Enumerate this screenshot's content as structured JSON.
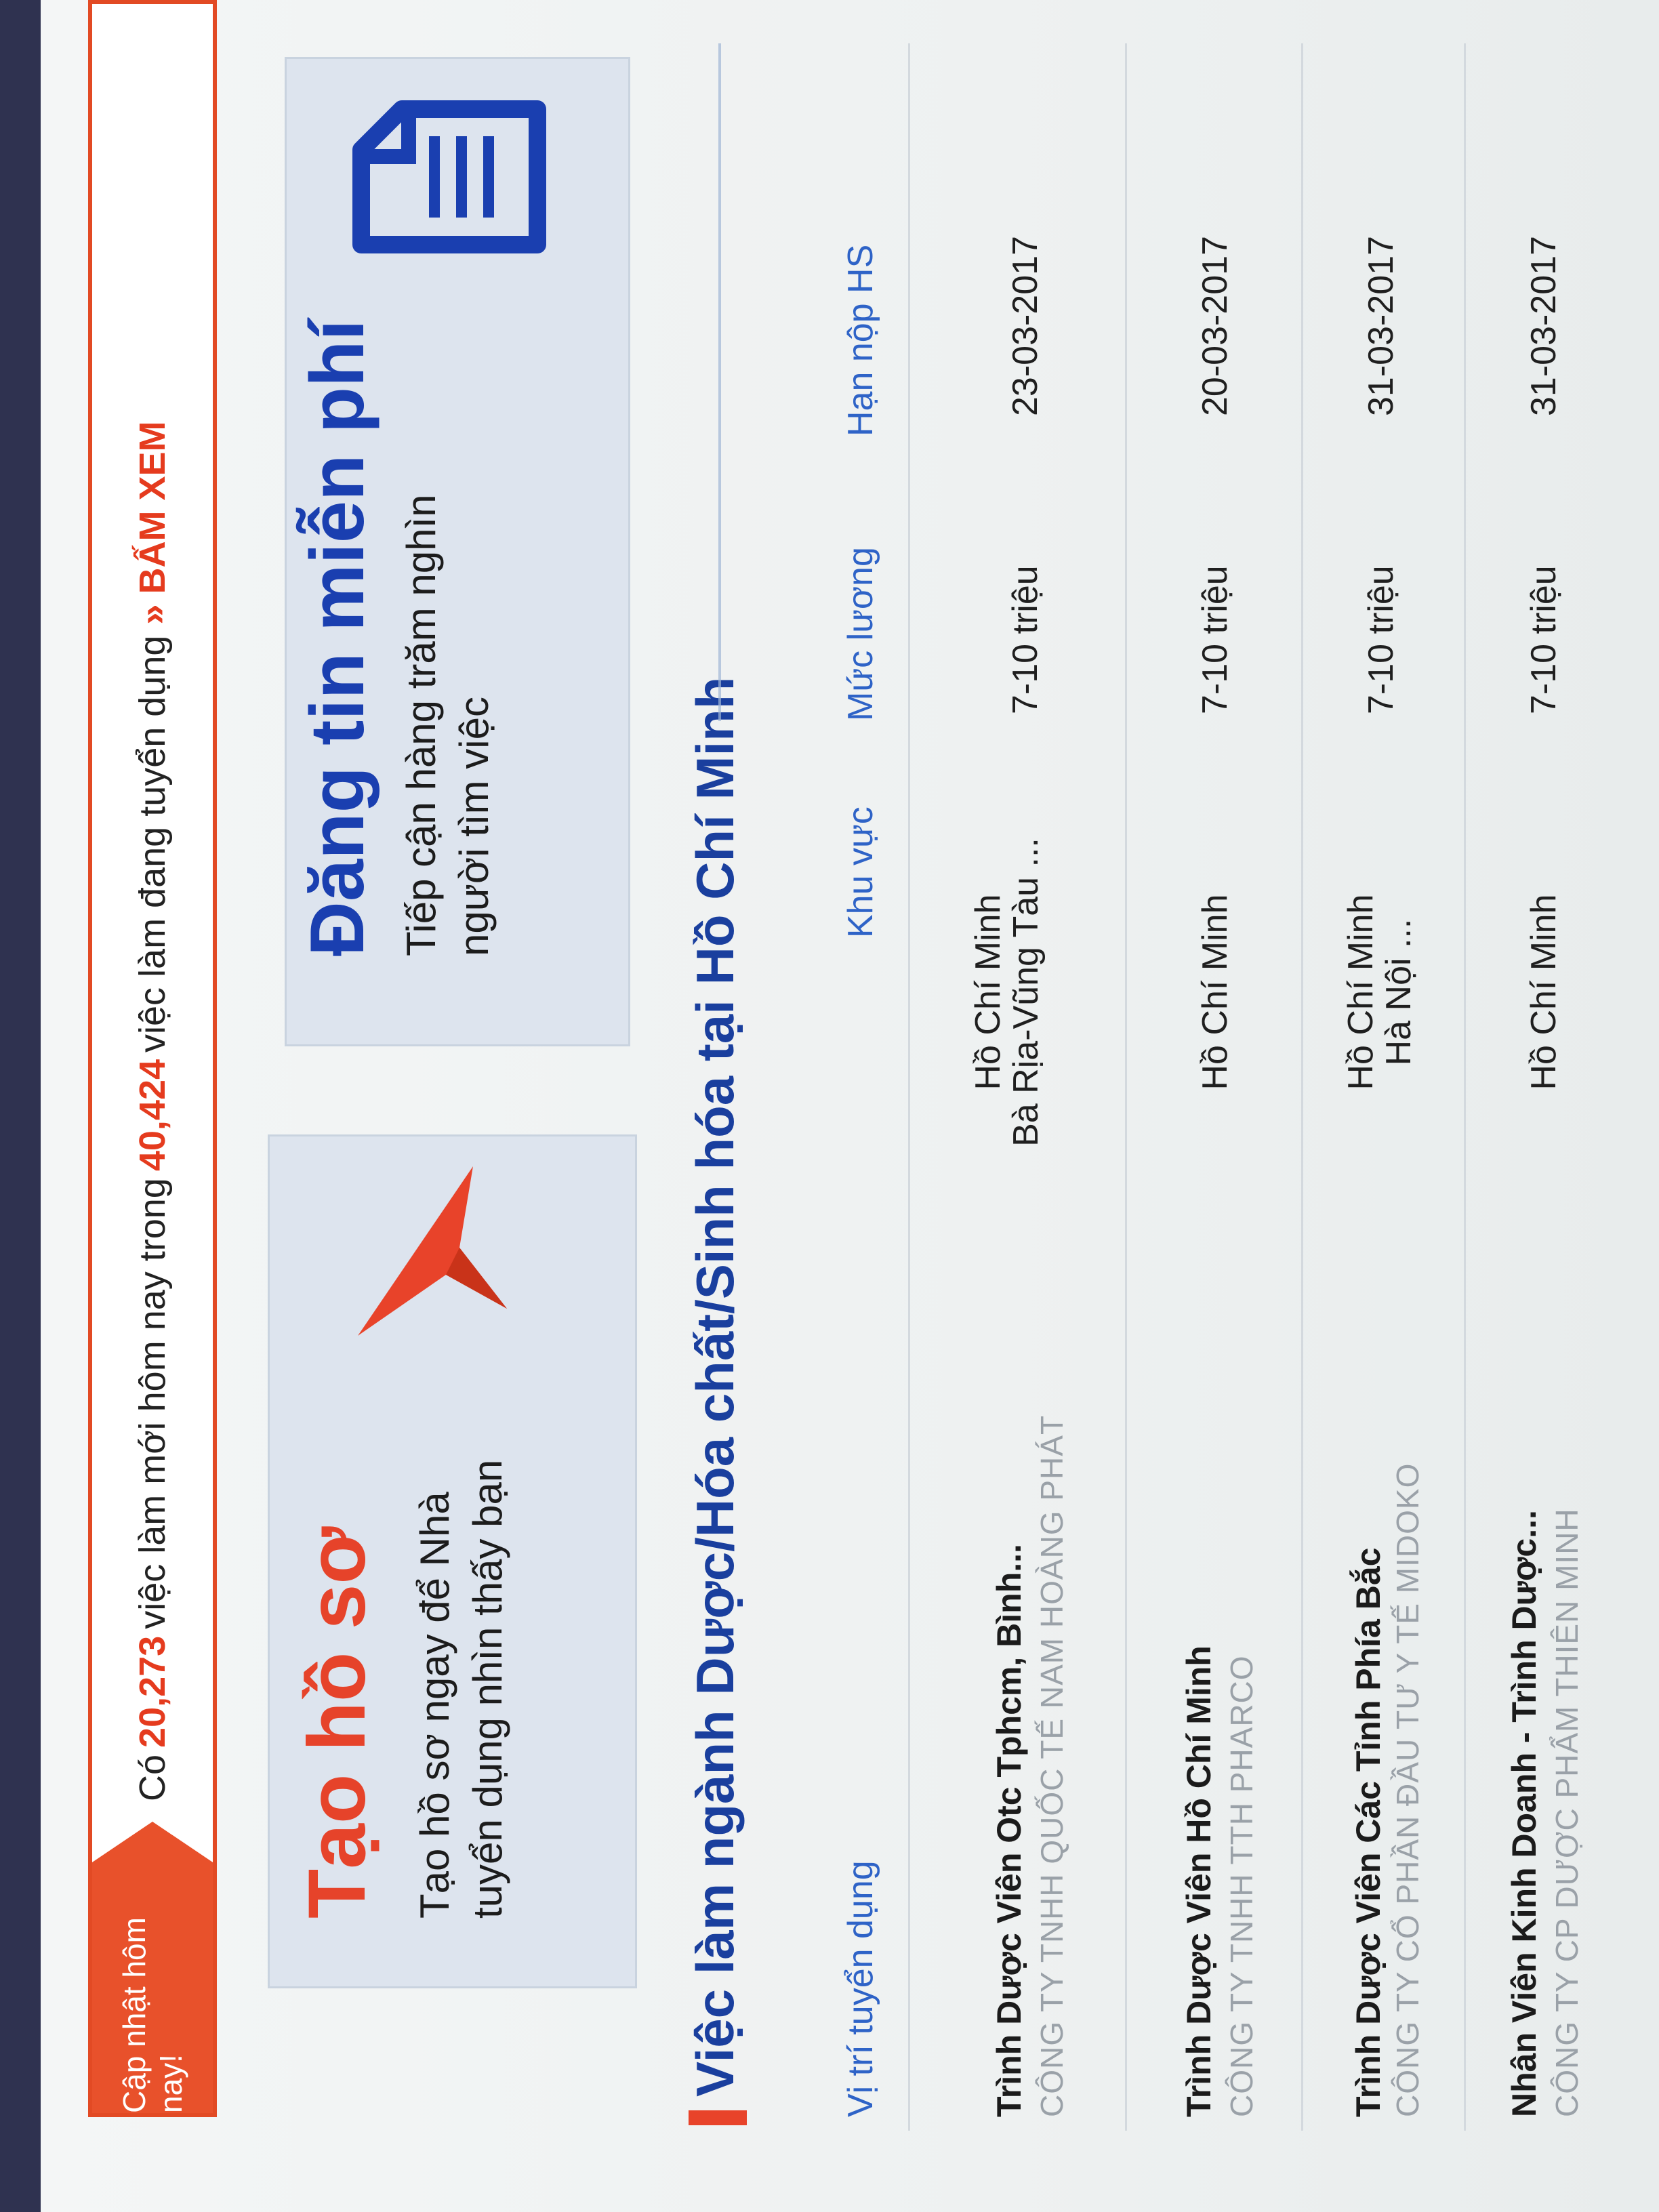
{
  "update_bar": {
    "badge": "Cập nhật hôm nay!",
    "prefix": "Có",
    "new_jobs_count": "20,273",
    "middle": "việc làm mới hôm nay trong",
    "total_jobs_count": "40,424",
    "suffix": "việc làm đang tuyển dụng",
    "cta": "»  BẤM XEM"
  },
  "promo": [
    {
      "title": "Tạo hồ sơ",
      "desc": "Tạo hồ sơ ngay để Nhà tuyển dụng nhìn thấy bạn",
      "icon": "paper-plane-icon"
    },
    {
      "title": "Đăng tin miễn phí",
      "desc": "Tiếp cận hàng trăm nghìn người tìm việc",
      "icon": "document-icon"
    }
  ],
  "section_title": "Việc làm ngành Dược/Hóa chất/Sinh hóa tại Hồ Chí Minh",
  "table": {
    "headers": {
      "position": "Vị trí tuyển dụng",
      "area": "Khu vực",
      "salary": "Mức lương",
      "deadline": "Hạn nộp HS"
    },
    "rows": [
      {
        "title": "Trình Dược Viên Otc Tphcm, Bình...",
        "company": "CÔNG TY TNHH QUỐC TẾ NAM HOÀNG PHÁT",
        "loc1": "Hồ Chí Minh",
        "loc2": "Bà Rịa-Vũng Tàu ...",
        "salary": "7-10 triệu",
        "deadline": "23-03-2017"
      },
      {
        "title": "Trình Dược Viên Hồ Chí Minh",
        "company": "CÔNG TY TNHH TTH PHARCO",
        "loc1": "Hồ Chí Minh",
        "loc2": "",
        "salary": "7-10 triệu",
        "deadline": "20-03-2017"
      },
      {
        "title": "Trình Dược Viên Các Tỉnh Phía Bắc",
        "company": "CÔNG TY CỔ PHẦN ĐẦU TƯ Y TẾ MIDOKO",
        "loc1": "Hồ Chí Minh",
        "loc2": "Hà Nội ...",
        "salary": "7-10 triệu",
        "deadline": "31-03-2017"
      },
      {
        "title": "Nhân Viên Kinh Doanh - Trình Dược...",
        "company": "CÔNG TY CP DƯỢC PHẨM THIÊN MINH",
        "loc1": "Hồ Chí Minh",
        "loc2": "",
        "salary": "7-10 triệu",
        "deadline": "31-03-2017"
      }
    ]
  },
  "colors": {
    "accent_red": "#e8512b",
    "brand_blue": "#1a3fb0"
  }
}
